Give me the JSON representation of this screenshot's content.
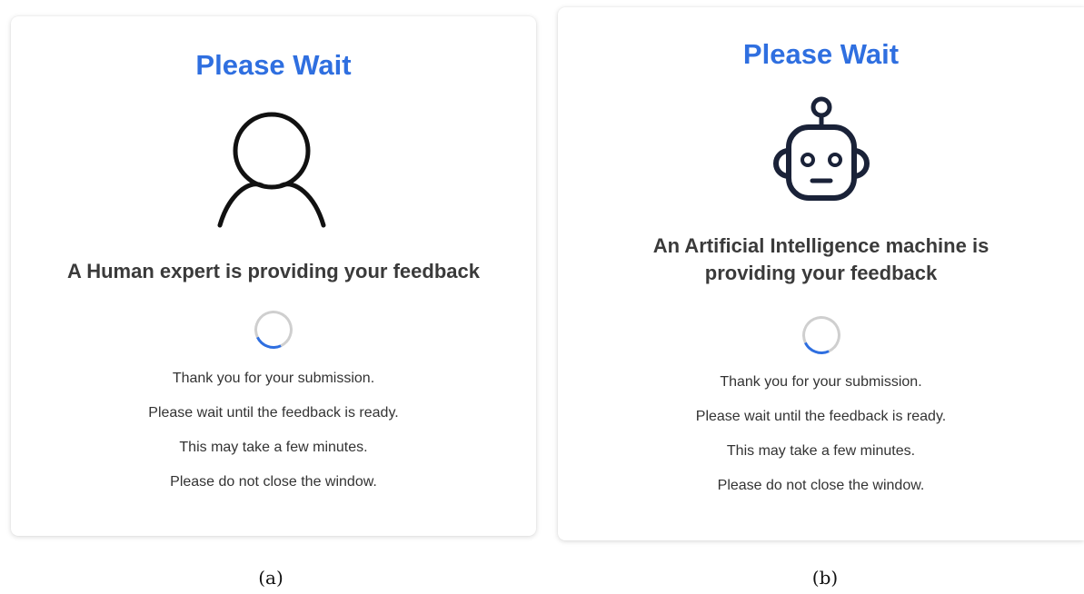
{
  "panels": [
    {
      "title": "Please Wait",
      "icon": "person-icon",
      "headline_lines": [
        "A Human expert is providing your feedback"
      ],
      "messages": [
        "Thank you for your submission.",
        "Please wait until the feedback is ready.",
        "This may take a few minutes.",
        "Please do not close the window."
      ],
      "caption": "(a)"
    },
    {
      "title": "Please Wait",
      "icon": "robot-icon",
      "headline_lines": [
        "An Artificial Intelligence machine is",
        "providing your feedback"
      ],
      "messages": [
        "Thank you for your submission.",
        "Please wait until the feedback is ready.",
        "This may take a few minutes.",
        "Please do not close the window."
      ],
      "caption": "(b)"
    }
  ],
  "colors": {
    "accent": "#2f6fe0",
    "text": "#333333",
    "robot": "#1a2238"
  }
}
